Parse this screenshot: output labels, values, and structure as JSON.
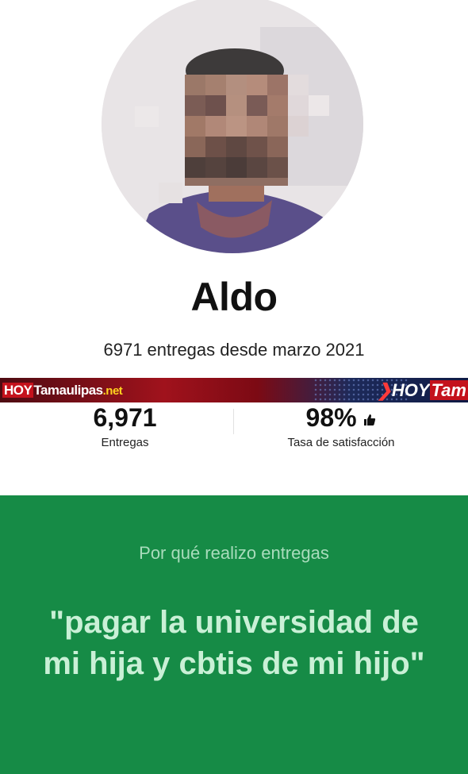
{
  "profile": {
    "name": "Aldo",
    "since_text": "6971 entregas desde marzo 2021"
  },
  "watermark": {
    "left_hoy": "HOY",
    "left_name": "Tamaulipas",
    "left_suffix": ".net",
    "right_mark": "❯",
    "right_hoy": "HOY",
    "right_tam": "Tam"
  },
  "stats": {
    "deliveries_value": "6,971",
    "deliveries_label": "Entregas",
    "satisfaction_value": "98%",
    "satisfaction_label": "Tasa de satisfacción",
    "satisfaction_icon": "thumbs-up-icon"
  },
  "reason": {
    "heading": "Por qué realizo entregas",
    "quote": "\"pagar la universidad de mi hija y cbtis de mi hijo\""
  },
  "colors": {
    "card_green": "#168b46",
    "quote_text": "#c9f0d6",
    "heading_text": "#a9dcbc"
  }
}
